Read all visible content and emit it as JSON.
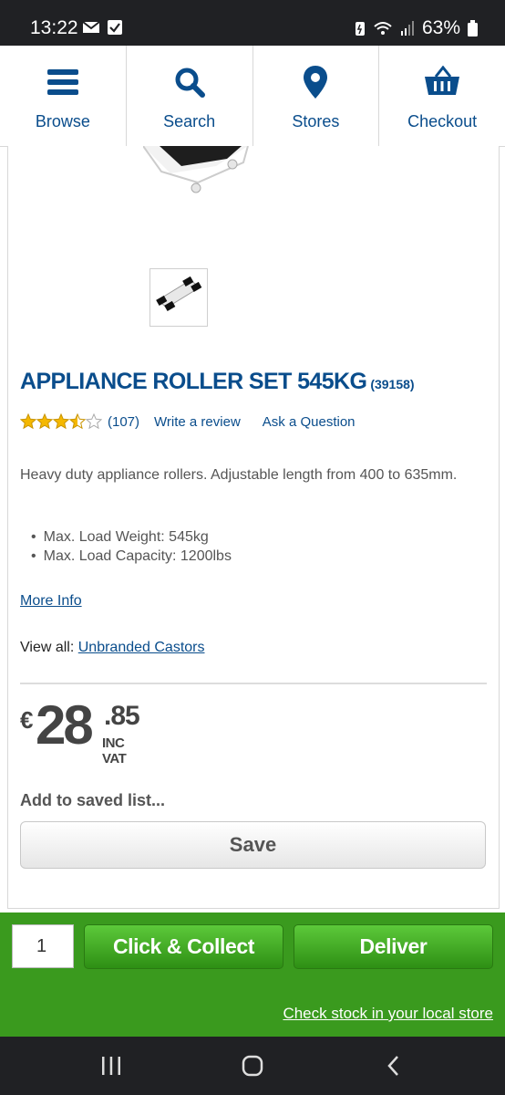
{
  "status_bar": {
    "time": "13:22",
    "battery": "63%"
  },
  "nav": {
    "items": [
      {
        "label": "Browse",
        "icon": "menu-icon"
      },
      {
        "label": "Search",
        "icon": "search-icon"
      },
      {
        "label": "Stores",
        "icon": "location-pin-icon"
      },
      {
        "label": "Checkout",
        "icon": "basket-icon"
      }
    ]
  },
  "product": {
    "title": "APPLIANCE ROLLER SET 545KG",
    "code": "(39158)",
    "rating": {
      "value": 3.5,
      "max": 5,
      "count": "(107)"
    },
    "write_review": "Write a review",
    "ask_question": "Ask a Question",
    "description": "Heavy duty appliance rollers. Adjustable length from 400 to 635mm.",
    "features": [
      "Max. Load Weight: 545kg",
      "Max. Load Capacity: 1200lbs"
    ],
    "more_info": "More Info",
    "view_all_label": "View all:",
    "view_all_link": "Unbranded Castors"
  },
  "price": {
    "currency": "€",
    "euros": "28",
    "cents": ".85",
    "vat_label": "INC VAT"
  },
  "saved_list": {
    "label": "Add to saved list...",
    "button": "Save"
  },
  "actions": {
    "quantity": "1",
    "click_collect": "Click & Collect",
    "deliver": "Deliver",
    "check_stock": "Check stock in your local store"
  },
  "colors": {
    "brand_blue": "#0a4d8c",
    "action_green": "#3a9a1e",
    "star_gold": "#f5b800"
  }
}
